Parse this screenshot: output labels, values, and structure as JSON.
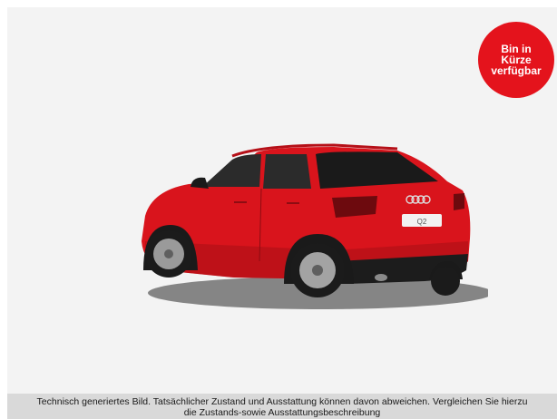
{
  "badge": {
    "lines": [
      "Bin in",
      "Kürze",
      "verfügbar"
    ],
    "color": "#e4131c"
  },
  "car": {
    "plate_text": "Q2",
    "body_color": "#d9141c"
  },
  "disclaimer": {
    "line1": "Technisch generiertes Bild. Tatsächlicher Zustand und Ausstattung können davon abweichen. Vergleichen Sie hierzu",
    "line2": "die Zustands-sowie Ausstattungsbeschreibung"
  }
}
